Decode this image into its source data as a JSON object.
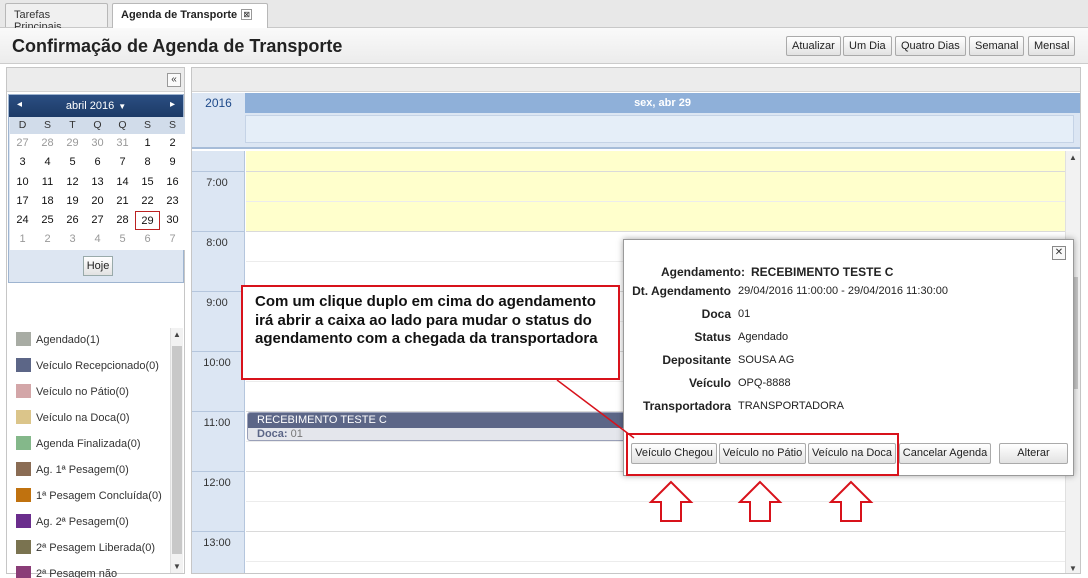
{
  "tabs": [
    {
      "label": "Tarefas Principais"
    },
    {
      "label": "Agenda de Transporte",
      "close": "⊠"
    }
  ],
  "header": {
    "title": "Confirmação de Agenda de Transporte",
    "buttons": [
      "Atualizar",
      "Um Dia",
      "Quatro Dias",
      "Semanal",
      "Mensal"
    ]
  },
  "sidebar": {
    "collapse_glyph": "«",
    "calendar": {
      "prev": "◂",
      "next": "▸",
      "month": "abril 2016",
      "month_caret": "▼",
      "dow": [
        "D",
        "S",
        "T",
        "Q",
        "Q",
        "S",
        "S"
      ],
      "days": [
        [
          "27",
          "28",
          "29",
          "30",
          "31",
          "1",
          "2"
        ],
        [
          "3",
          "4",
          "5",
          "6",
          "7",
          "8",
          "9"
        ],
        [
          "10",
          "11",
          "12",
          "13",
          "14",
          "15",
          "16"
        ],
        [
          "17",
          "18",
          "19",
          "20",
          "21",
          "22",
          "23"
        ],
        [
          "24",
          "25",
          "26",
          "27",
          "28",
          "29",
          "30"
        ],
        [
          "1",
          "2",
          "3",
          "4",
          "5",
          "6",
          "7"
        ]
      ],
      "selected": "29",
      "today_button": "Hoje"
    },
    "legend": [
      {
        "label": "Agendado(1)",
        "color": "#a8aca4"
      },
      {
        "label": "Veículo Recepcionado(0)",
        "color": "#5c6687"
      },
      {
        "label": "Veículo no Pátio(0)",
        "color": "#d3a6a8"
      },
      {
        "label": "Veículo na Doca(0)",
        "color": "#dbc58a"
      },
      {
        "label": "Agenda Finalizada(0)",
        "color": "#84b88a"
      },
      {
        "label": "Ag. 1ª Pesagem(0)",
        "color": "#8a6c54"
      },
      {
        "label": "1ª Pesagem Concluída(0)",
        "color": "#c0720f"
      },
      {
        "label": "Ag. 2ª Pesagem(0)",
        "color": "#6a2d8c"
      },
      {
        "label": "2ª Pesagem Liberada(0)",
        "color": "#7a7350"
      },
      {
        "label": "2ª Pesagem não",
        "color": "#8a3d77"
      }
    ]
  },
  "calendar_view": {
    "year": "2016",
    "day_header": "sex, abr 29",
    "times": [
      "7:00",
      "8:00",
      "9:00",
      "10:00",
      "11:00",
      "12:00",
      "13:00"
    ],
    "event": {
      "title": "RECEBIMENTO TESTE C",
      "sub_label": "Doca:",
      "sub_value": "01"
    }
  },
  "popup": {
    "close": "✕",
    "fields": [
      {
        "label": "Agendamento:",
        "value": "RECEBIMENTO TESTE C"
      },
      {
        "label": "Dt. Agendamento",
        "value": "29/04/2016 11:00:00 - 29/04/2016 11:30:00"
      },
      {
        "label": "Doca",
        "value": "01"
      },
      {
        "label": "Status",
        "value": "Agendado"
      },
      {
        "label": "Depositante",
        "value": "SOUSA AG"
      },
      {
        "label": "Veículo",
        "value": "OPQ-8888"
      },
      {
        "label": "Transportadora",
        "value": "TRANSPORTADORA"
      }
    ],
    "buttons": [
      "Veículo Chegou",
      "Veículo no Pátio",
      "Veículo na Doca",
      "Cancelar Agenda",
      "Alterar"
    ]
  },
  "annotation": {
    "callout_text": "Com um clique duplo em cima do agendamento irá abrir a caixa ao lado para mudar o status do agendamento com a chegada da transportadora",
    "accent_color": "#d8121b"
  }
}
